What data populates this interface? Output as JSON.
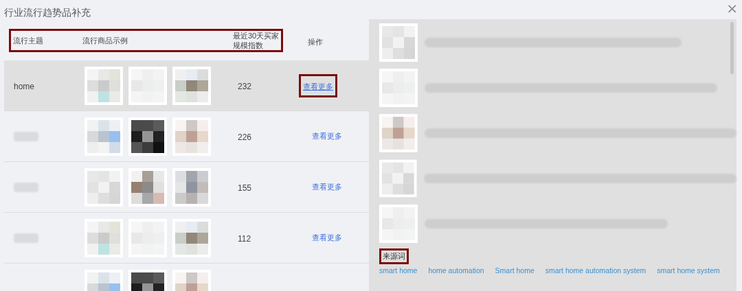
{
  "dialog": {
    "title": "行业流行趋势品补充",
    "close": "×"
  },
  "table": {
    "columns": [
      "流行主题",
      "流行商品示例",
      "最近30天买家规模指数",
      "操作"
    ],
    "header_highlighted": true,
    "rows": [
      {
        "theme": "home",
        "count": "232",
        "action": "查看更多",
        "selected": true,
        "action_highlighted": true
      },
      {
        "theme_blurred": true,
        "count": "226",
        "action": "查看更多",
        "selected": false,
        "action_highlighted": false
      },
      {
        "theme_blurred": true,
        "count": "155",
        "action": "查看更多",
        "selected": false,
        "action_highlighted": false
      },
      {
        "theme_blurred": true,
        "count": "112",
        "action": "查看更多",
        "selected": false,
        "action_highlighted": false
      },
      {
        "selected": false
      }
    ]
  },
  "detail": {
    "source_label": "来源词",
    "source_label_highlighted": true,
    "source_words": [
      "smart home",
      "home automation",
      "Smart home",
      "smart home automation system",
      "smart home system"
    ]
  }
}
